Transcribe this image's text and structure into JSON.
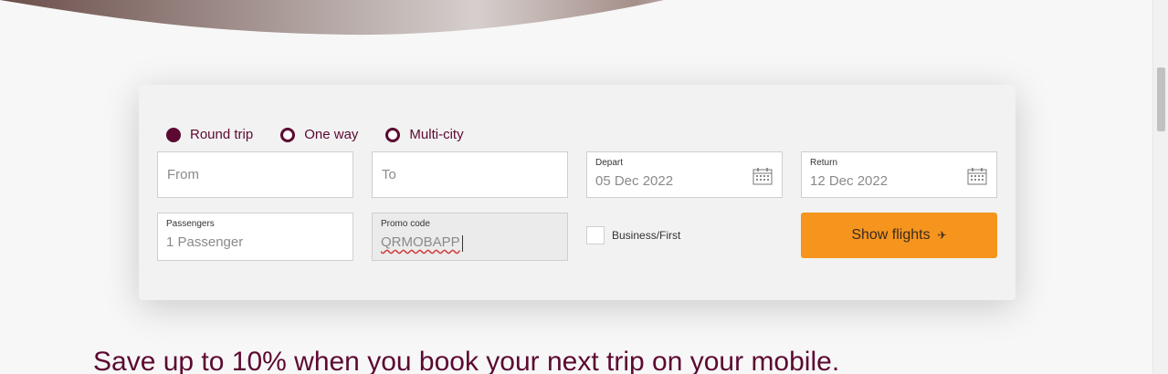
{
  "trip_types": [
    {
      "label": "Round trip",
      "checked": true
    },
    {
      "label": "One way",
      "checked": false
    },
    {
      "label": "Multi-city",
      "checked": false
    }
  ],
  "from": {
    "placeholder": "From"
  },
  "to": {
    "placeholder": "To"
  },
  "depart": {
    "label": "Depart",
    "value": "05 Dec 2022"
  },
  "return": {
    "label": "Return",
    "value": "12 Dec 2022"
  },
  "passengers": {
    "label": "Passengers",
    "value": "1 Passenger"
  },
  "promo": {
    "label": "Promo code",
    "value": "QRMOBAPP"
  },
  "business": {
    "label": "Business/First",
    "checked": false
  },
  "show_flights": {
    "label": "Show flights"
  },
  "headline": "Save up to 10% when you book your next trip on your mobile.",
  "colors": {
    "brand": "#5c0931",
    "accent": "#f5951e"
  }
}
